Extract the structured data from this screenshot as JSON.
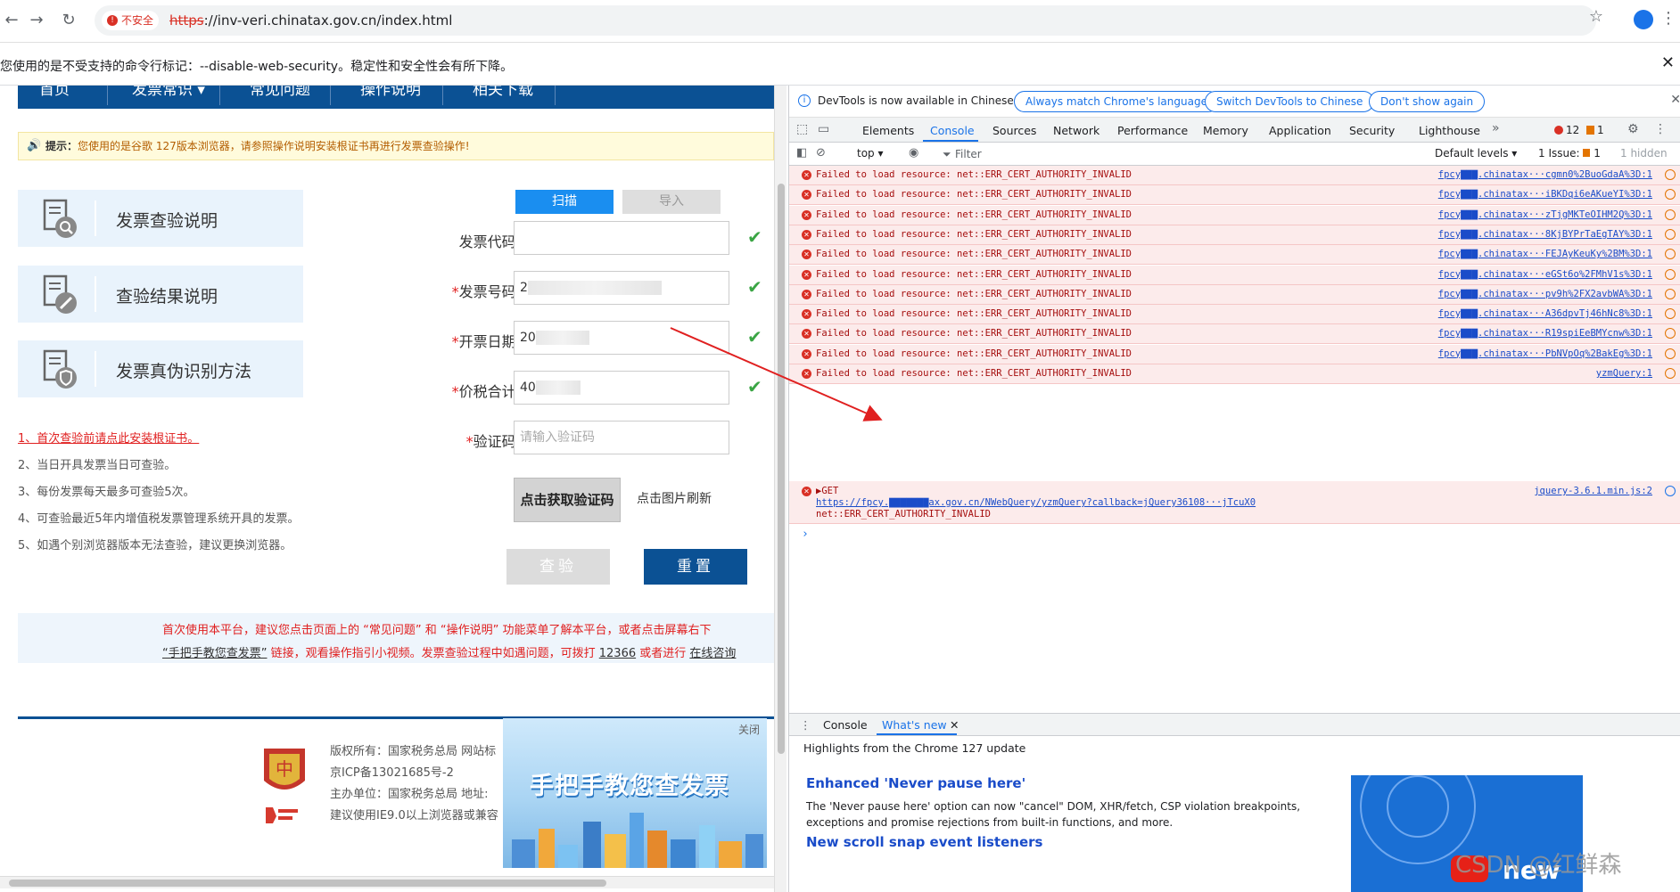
{
  "browser": {
    "security_label": "不安全",
    "url_scheme": "https",
    "url_rest": "://inv-veri.chinatax.gov.cn/index.html",
    "infobar_text": "您使用的是不受支持的命令行标记：--disable-web-security。稳定性和安全性会有所下降。"
  },
  "site": {
    "nav": [
      "首页",
      "发票常识 ▾",
      "常见问题",
      "操作说明",
      "相关下载"
    ],
    "tip_bold": "提示：",
    "tip_text": "您使用的是谷歌 127版本浏览器，请参照操作说明安装根证书再进行发票查验操作!",
    "side_cards": [
      "发票查验说明",
      "查验结果说明",
      "发票真伪识别方法"
    ],
    "notes_first": "1、首次查验前请点此安装根证书。",
    "notes": [
      "2、当日开具发票当日可查验。",
      "3、每份发票每天最多可查验5次。",
      "4、可查验最近5年内增值税发票管理系统开具的发票。",
      "5、如遇个别浏览器版本无法查验，建议更换浏览器。"
    ],
    "tab_scan": "扫描",
    "tab_import": "导入",
    "fields": {
      "code_label": "发票代码:",
      "number_label": "发票号码:",
      "number_value": "2",
      "date_label": "开票日期:",
      "date_value": "20",
      "amount_label": "价税合计:",
      "amount_value": "40",
      "captcha_label": "验证码:",
      "captcha_placeholder": "请输入验证码"
    },
    "captcha_img_text": "点击获取验证码",
    "captcha_hint": "点击图片刷新",
    "btn_verify": "查验",
    "btn_reset": "重置",
    "help_line1": "首次使用本平台，建议您点击页面上的 “常见问题” 和 “操作说明” 功能菜单了解本平台，或者点击屏幕右下",
    "help_line2_a": "“手把手教您查发票”",
    "help_line2_b": " 链接，观看操作指引小视频。发票查验过程中如遇问题，可拨打 ",
    "help_line2_c": "12366",
    "help_line2_d": " 或者进行 ",
    "help_line2_e": "在线咨询",
    "footer": [
      "版权所有：国家税务总局 网站标",
      "京ICP备13021685号-2 ",
      "主办单位：国家税务总局 地址:",
      "建议使用IE9.0以上浏览器或兼容"
    ],
    "promo_close": "关闭",
    "promo_title": "手把手教您查发票"
  },
  "devtools": {
    "banner_msg": "DevTools is now available in Chinese!",
    "banner_btn1": "Always match Chrome's language",
    "banner_btn2": "Switch DevTools to Chinese",
    "banner_btn3": "Don't show again",
    "tabs": [
      "Elements",
      "Console",
      "Sources",
      "Network",
      "Performance",
      "Memory",
      "Application",
      "Security",
      "Lighthouse"
    ],
    "error_count": "12",
    "warning_count": "1",
    "context": "top",
    "filter_placeholder": "Filter",
    "levels": "Default levels",
    "issues": "1 Issue:",
    "issues_count": "1",
    "hidden": "1 hidden",
    "log_message": "Failed to load resource: net::ERR_CERT_AUTHORITY_INVALID",
    "log_sources": [
      "fpcy▇▇▇.chinatax···cgmn0%2BuoGdaA%3D:1",
      "fpcy▇▇▇.chinatax···iBKDqi6eAKueYI%3D:1",
      "fpcy▇▇▇.chinatax···zTjgMKTeOIHM2Q%3D:1",
      "fpcy▇▇▇.chinatax···8KjBYPrTaEgTAY%3D:1",
      "fpcy▇▇▇.chinatax···FEJAyKeuKy%2BM%3D:1",
      "fpcy▇▇▇.chinatax···eGSt6o%2FMhV1s%3D:1",
      "fpcy▇▇▇.chinatax···pv9h%2FX2avbWA%3D:1",
      "fpcy▇▇▇.chinatax···A36dpvTj46hNc8%3D:1",
      "fpcy▇▇▇.chinatax···R19spiEeBMYcnw%3D:1",
      "fpcy▇▇▇.chinatax···PbNVpOq%2BakEg%3D:1",
      "yzmQuery:1"
    ],
    "get_line": "▶GET",
    "get_url": "https://fpcy.▇▇▇▇▇▇▇ax.gov.cn/NWebQuery/yzmQuery?callback=jQuery36108···jTcuX0",
    "get_error": "net::ERR_CERT_AUTHORITY_INVALID",
    "get_source": "jquery-3.6.1.min.js:2",
    "drawer_tabs": [
      "Console",
      "What's new"
    ],
    "whatsnew_header": "Highlights from the Chrome 127 update",
    "wn_title1": "Enhanced 'Never pause here'",
    "wn_text1": "The 'Never pause here' option can now \"cancel\" DOM, XHR/fetch, CSP violation breakpoints, exceptions and promise rejections from built-in functions, and more.",
    "wn_title2": "New scroll snap event listeners",
    "wn_thumb_text": "new"
  },
  "watermark": "CSDN @红鲜森",
  "colors": {
    "accent": "#0b5194",
    "devtools_blue": "#1a73e8",
    "error_red": "#d93025"
  }
}
